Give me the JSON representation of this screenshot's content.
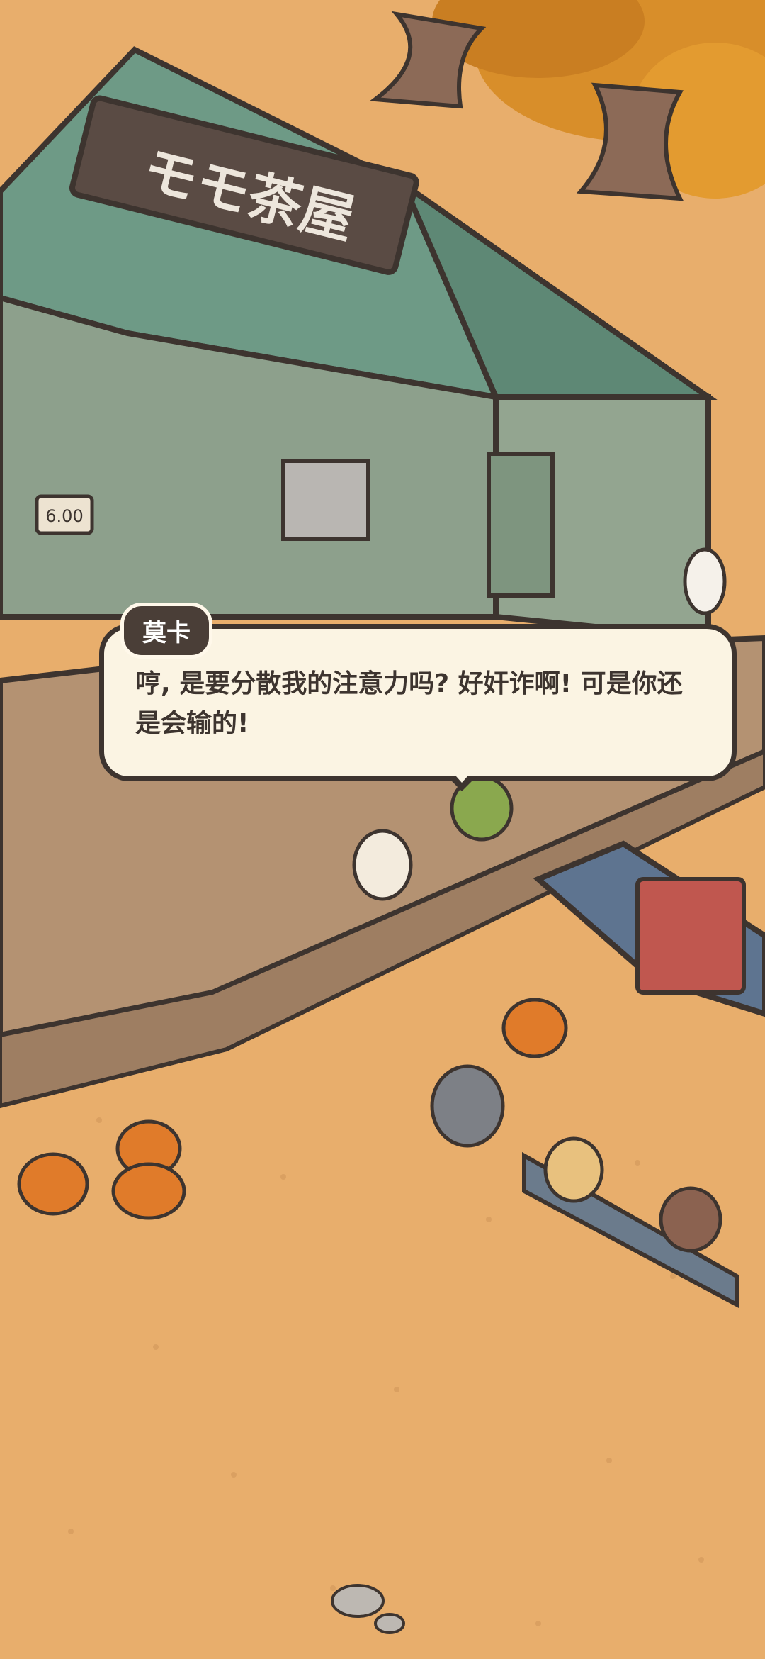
{
  "scene": {
    "teahouse_sign": "モモ茶屋",
    "price_tag": "6.00"
  },
  "dialog": {
    "speaker": "莫卡",
    "line1": "哼, 是要分散我的注意力吗? 好奸诈啊! 可是你还",
    "line2": "是会输的!"
  },
  "colors": {
    "ground": "#E8AE6C",
    "roof": "#6E9A86",
    "wood": "#B49272",
    "bubble": "#FBF4E3",
    "outline": "#3D342F"
  }
}
